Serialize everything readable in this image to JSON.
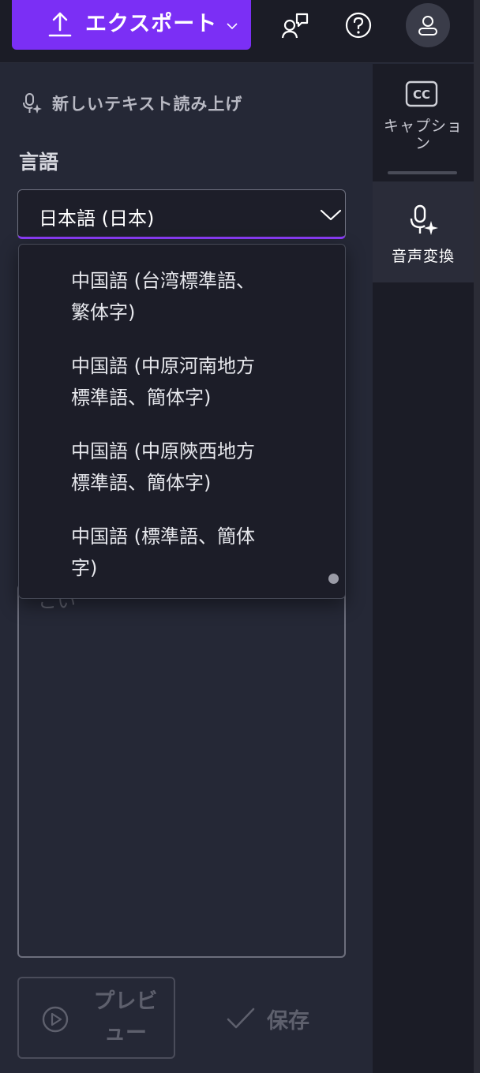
{
  "topbar": {
    "export_label": "エクスポート",
    "icons": [
      "upload-icon",
      "chevron-down-icon",
      "feedback-icon",
      "help-icon",
      "user-icon"
    ]
  },
  "rail": {
    "caption_label": "キャプション",
    "tts_label": "音声変換"
  },
  "panel": {
    "title": "新しいテキスト読み上げ",
    "language_label": "言語",
    "selected_language": "日本語 (日本)",
    "options": [
      {
        "line1": "中国語 (台湾標準語、",
        "line2": "繁体字)"
      },
      {
        "line1": "中国語 (中原河南地方",
        "line2": "標準語、簡体字)"
      },
      {
        "line1": "中国語 (中原陝西地方",
        "line2": "標準語、簡体字)"
      },
      {
        "line1": "中国語 (標準語、簡体",
        "line2": "字)"
      }
    ],
    "textarea_placeholder_fragment": "こい",
    "preview_line1": "プレビ",
    "preview_line2": "ュー",
    "save_label": "保存"
  },
  "colors": {
    "accent": "#7b2ff5",
    "background": "#252836",
    "topbar": "#1b1c26"
  }
}
